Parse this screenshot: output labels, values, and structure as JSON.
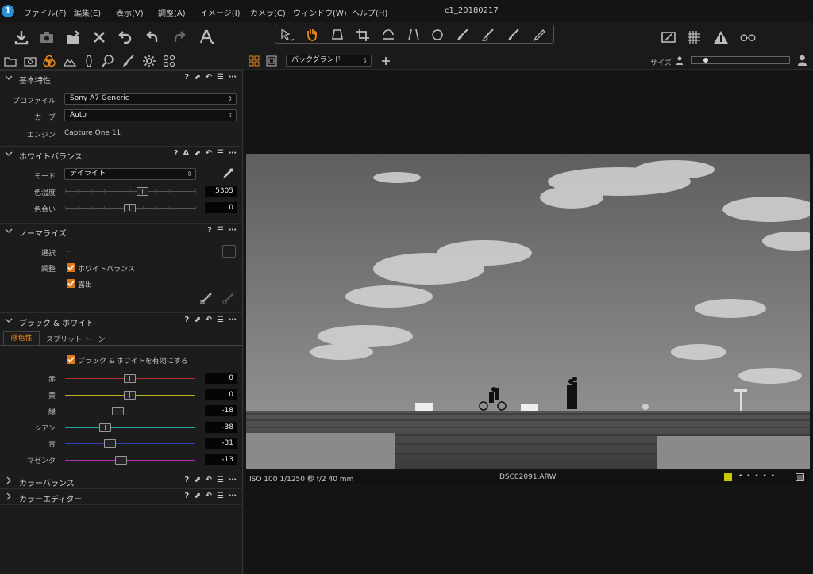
{
  "app": {
    "logo": "1",
    "window_title": "c1_20180217"
  },
  "menu": [
    "ファイル(F)",
    "編集(E)",
    "表示(V)",
    "調整(A)",
    "イメージ(I)",
    "カメラ(C)",
    "ウィンドウ(W)",
    "ヘルプ(H)"
  ],
  "toolbar": {
    "left_icons": [
      "import-icon",
      "capture-icon",
      "export-icon",
      "delete-icon",
      "undo-history-icon",
      "undo-icon",
      "redo-icon",
      "text-tool-icon"
    ],
    "cursor_tools": [
      "select-cursor-icon",
      "pan-hand-icon",
      "crop-tool-icon",
      "crop-icon",
      "rotate-icon",
      "keystone-icon",
      "spot-removal-icon",
      "brush-icon",
      "eraser-icon",
      "gradient-mask-icon",
      "eyedropper-mask-icon"
    ],
    "right_icons": [
      "edit-mask-icon",
      "grid-icon",
      "exposure-warning-icon",
      "loupe-icon"
    ]
  },
  "tool_tabs": [
    "library-tab-icon",
    "capture-tab-icon",
    "color-tab-icon",
    "exposure-tab-icon",
    "lens-tab-icon",
    "details-tab-icon",
    "local-adjust-tab-icon",
    "settings-tab-icon",
    "batch-tab-icon"
  ],
  "base_characteristics": {
    "title": "基本特性",
    "profile_label": "プロファイル",
    "profile_value": "Sony A7 Generic",
    "curve_label": "カーブ",
    "curve_value": "Auto",
    "engine_label": "エンジン",
    "engine_value": "Capture One 11"
  },
  "white_balance": {
    "title": "ホワイトバランス",
    "mode_label": "モード",
    "mode_value": "デイライト",
    "temp_label": "色温度",
    "temp_value": "5305",
    "tint_label": "色合い",
    "tint_value": "0",
    "temp_position": 0.6,
    "tint_position": 0.5
  },
  "normalize": {
    "title": "ノーマライズ",
    "select_label": "選択",
    "select_value": "--",
    "adjust_label": "調整",
    "wb_check_label": "ホワイトバランス",
    "exposure_check_label": "露出",
    "more_button": "..."
  },
  "black_white": {
    "title": "ブラック & ホワイト",
    "tab_sensitivity": "感色性",
    "tab_split": "スプリット トーン",
    "enable_label": "ブラック & ホワイトを有効にする",
    "channels": [
      {
        "label": "赤",
        "value": "0",
        "color": "#b23030",
        "pos": 0.5
      },
      {
        "label": "黄",
        "value": "0",
        "color": "#b8b020",
        "pos": 0.5
      },
      {
        "label": "緑",
        "value": "-18",
        "color": "#30a030",
        "pos": 0.41
      },
      {
        "label": "シアン",
        "value": "-38",
        "color": "#2aa0b0",
        "pos": 0.31
      },
      {
        "label": "青",
        "value": "-31",
        "color": "#3040b8",
        "pos": 0.345
      },
      {
        "label": "マゼンタ",
        "value": "-13",
        "color": "#b030b0",
        "pos": 0.435
      }
    ]
  },
  "color_balance": {
    "title": "カラーバランス"
  },
  "color_editor": {
    "title": "カラーエディター"
  },
  "section_controls": {
    "help": "?",
    "auto": "A"
  },
  "viewer": {
    "background_label": "バックグランド",
    "size_label": "サイズ",
    "photo_exif": "ISO 100  1/1250 秒  f/2  40 mm",
    "photo_filename": "DSC02091.ARW",
    "rating_dots": "•  •  •  •  •",
    "color_tag": "#c8c800",
    "size_slider_position": 0.12
  }
}
